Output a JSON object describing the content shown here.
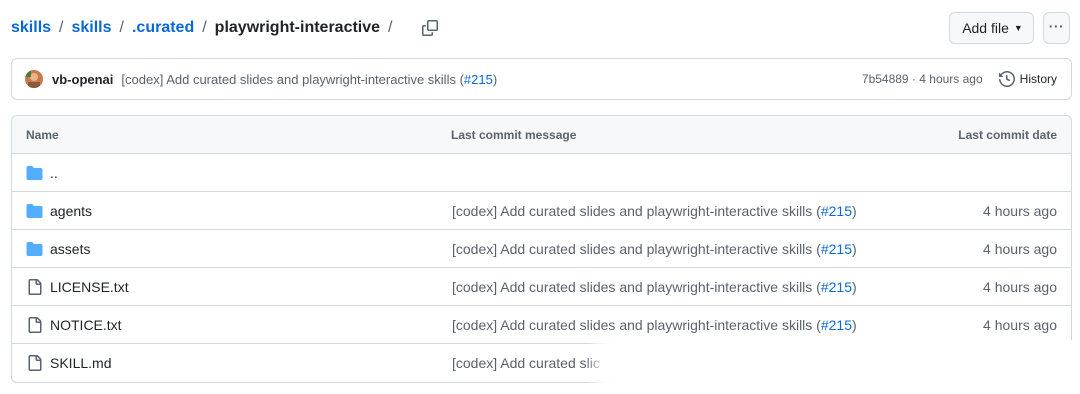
{
  "breadcrumb": {
    "items": [
      "skills",
      "skills",
      ".curated"
    ],
    "current": "playwright-interactive",
    "separator": "/"
  },
  "actions": {
    "add_file_label": "Add file",
    "more_label": "···"
  },
  "commit": {
    "author": "vb-openai",
    "message_prefix": "[codex] Add curated slides and playwright-interactive skills (",
    "pr_link": "#215",
    "message_suffix": ")",
    "meta": "7b54889 · 4 hours ago",
    "history_label": "History"
  },
  "table": {
    "headers": {
      "name": "Name",
      "message": "Last commit message",
      "date": "Last commit date"
    },
    "rows": [
      {
        "type": "folder",
        "name": "..",
        "message_prefix": "",
        "pr": "",
        "message_suffix": "",
        "date": ""
      },
      {
        "type": "folder",
        "name": "agents",
        "message_prefix": "[codex] Add curated slides and playwright-interactive skills (",
        "pr": "#215",
        "message_suffix": ")",
        "date": "4 hours ago"
      },
      {
        "type": "folder",
        "name": "assets",
        "message_prefix": "[codex] Add curated slides and playwright-interactive skills (",
        "pr": "#215",
        "message_suffix": ")",
        "date": "4 hours ago"
      },
      {
        "type": "file",
        "name": "LICENSE.txt",
        "message_prefix": "[codex] Add curated slides and playwright-interactive skills (",
        "pr": "#215",
        "message_suffix": ")",
        "date": "4 hours ago"
      },
      {
        "type": "file",
        "name": "NOTICE.txt",
        "message_prefix": "[codex] Add curated slides and playwright-interactive skills (",
        "pr": "#215",
        "message_suffix": ")",
        "date": "4 hours ago"
      },
      {
        "type": "file",
        "name": "SKILL.md",
        "message_prefix": "[codex] Add curated slic",
        "pr": "",
        "message_suffix": "",
        "date": ""
      }
    ]
  },
  "icons": {
    "copy": "copy-icon",
    "history": "history-icon",
    "folder": "folder-icon",
    "file": "file-icon"
  },
  "colors": {
    "link": "#0969da",
    "folder": "#54aeff",
    "muted": "#59636e",
    "border": "#d1d9e0",
    "header_bg": "#f6f8fa"
  }
}
